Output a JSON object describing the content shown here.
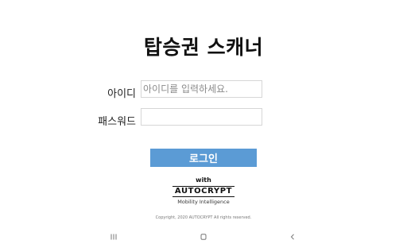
{
  "app": {
    "title": "탑승권 스캐너"
  },
  "form": {
    "id_label": "아이디",
    "id_placeholder": "아이디를 입력하세요.",
    "id_value": "",
    "password_label": "패스워드",
    "password_placeholder": "",
    "password_value": "",
    "login_label": "로그인"
  },
  "footer": {
    "with_text": "with",
    "brand_name": "AUTOCRYPT",
    "brand_tagline": "Mobility Intelligence",
    "copyright": "Copyright, 2020 AUTOCRYPT All rights reserved."
  },
  "navbar": {
    "icons": [
      "recent-apps-icon",
      "home-icon",
      "back-icon"
    ]
  },
  "colors": {
    "button_bg": "#5b9bd5",
    "button_text": "#ffffff"
  }
}
